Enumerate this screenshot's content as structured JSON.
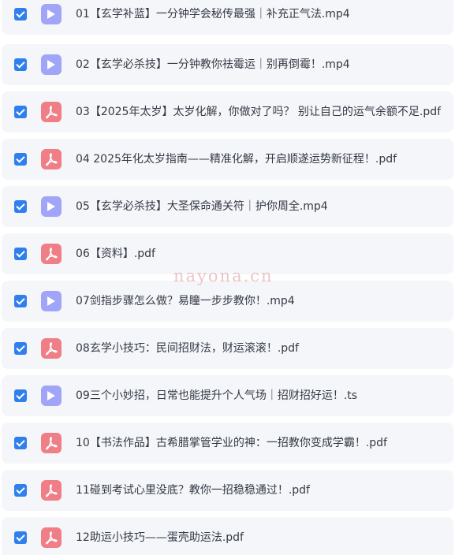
{
  "files": [
    {
      "type": "video",
      "icon": "play-video-icon",
      "checked": true,
      "name": "01【玄学补蓝】一分钟学会秘传最强｜补充正气法.mp4"
    },
    {
      "type": "video",
      "icon": "play-video-icon",
      "checked": true,
      "name": "02【玄学必杀技】一分钟教你祛霉运｜别再倒霉！.mp4"
    },
    {
      "type": "pdf",
      "icon": "pdf-icon",
      "checked": true,
      "name": "03【2025年太岁】太岁化解，你做对了吗？ 别让自己的运气余额不足.pdf"
    },
    {
      "type": "pdf",
      "icon": "pdf-icon",
      "checked": true,
      "name": "04 2025年化太岁指南——精准化解，开启顺遂运势新征程！.pdf"
    },
    {
      "type": "video",
      "icon": "play-video-icon",
      "checked": true,
      "name": "05【玄学必杀技】大圣保命通关符｜护你周全.mp4"
    },
    {
      "type": "pdf",
      "icon": "pdf-icon",
      "checked": true,
      "name": "06【资料】.pdf"
    },
    {
      "type": "video",
      "icon": "play-video-icon",
      "checked": true,
      "name": "07剑指步骤怎么做？易瞳一步步教你！.mp4"
    },
    {
      "type": "pdf",
      "icon": "pdf-icon",
      "checked": true,
      "name": "08玄学小技巧：民间招财法，财运滚滚！.pdf"
    },
    {
      "type": "video",
      "icon": "play-video-icon",
      "checked": true,
      "name": "09三个小妙招，日常也能提升个人气场｜招财招好运！.ts"
    },
    {
      "type": "pdf",
      "icon": "pdf-icon",
      "checked": true,
      "name": "10【书法作品】古希腊掌管学业的神：一招教你变成学霸！.pdf"
    },
    {
      "type": "pdf",
      "icon": "pdf-icon",
      "checked": true,
      "name": "11碰到考试心里没底？教你一招稳稳通过！.pdf"
    },
    {
      "type": "pdf",
      "icon": "pdf-icon",
      "checked": true,
      "name": "12助运小技巧——蛋壳助运法.pdf"
    }
  ],
  "watermark": "nayona.cn",
  "colors": {
    "checkbox": "#2f80ed",
    "video_icon": "#a0a5f8",
    "pdf_icon": "#f07e86",
    "row_background": "#f5f6f9",
    "text": "#333a45"
  }
}
